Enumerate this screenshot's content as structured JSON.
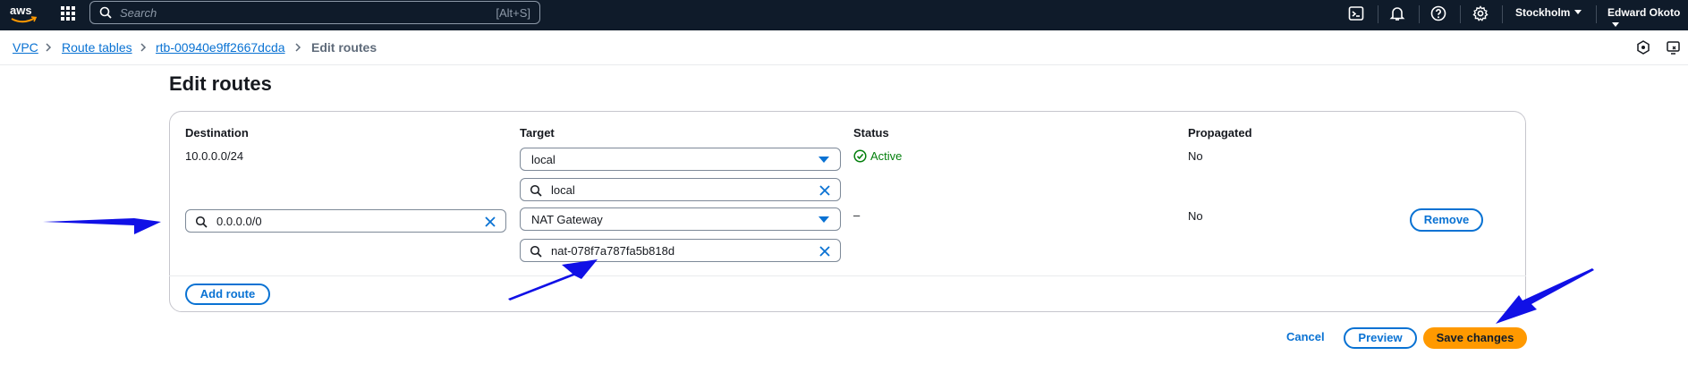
{
  "topnav": {
    "search_placeholder": "Search",
    "search_shortcut": "[Alt+S]",
    "region": "Stockholm",
    "user": "Edward Okoto"
  },
  "breadcrumb": [
    "VPC",
    "Route tables",
    "rtb-00940e9ff2667dcda",
    "Edit routes"
  ],
  "page": {
    "title": "Edit routes"
  },
  "table": {
    "headers": {
      "destination": "Destination",
      "target": "Target",
      "status": "Status",
      "propagated": "Propagated"
    },
    "rows": [
      {
        "destination": "10.0.0.0/24",
        "target_select": "local",
        "target_filter": "local",
        "status": "Active",
        "propagated": "No"
      },
      {
        "destination_input": "0.0.0.0/0",
        "target_select": "NAT Gateway",
        "target_filter": "nat-078f7a787fa5b818d",
        "status": "–",
        "propagated": "No",
        "remove_label": "Remove"
      }
    ],
    "add_route_label": "Add route"
  },
  "footer": {
    "cancel": "Cancel",
    "preview": "Preview",
    "save": "Save changes"
  },
  "colors": {
    "link": "#0972d3",
    "primary": "#ff9900",
    "success": "#037f0c",
    "annotation_arrow": "#1010e6",
    "nav_bg": "#0f1b2a"
  }
}
